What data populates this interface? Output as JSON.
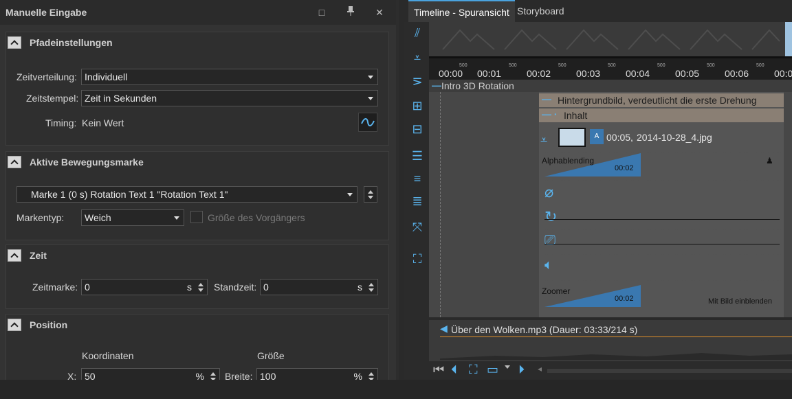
{
  "colors": {
    "accent": "#4aa3df",
    "panel": "#333333",
    "track_bg": "#8a7f74",
    "audio_line": "#e0902a",
    "keyframe": "#3a78b0"
  },
  "left_panel": {
    "title": "Manuelle Eingabe",
    "buttons": {
      "maximize": "□",
      "pin": "pin-icon",
      "close": "✕"
    },
    "pfad": {
      "title": "Pfadeinstellungen",
      "zeitverteilung_label": "Zeitverteilung:",
      "zeitverteilung_value": "Individuell",
      "zeitstempel_label": "Zeitstempel:",
      "zeitstempel_value": "Zeit in Sekunden",
      "timing_label": "Timing:",
      "timing_value": "Kein Wert"
    },
    "marke": {
      "title": "Aktive Bewegungsmarke",
      "selected": "Marke 1 (0 s) Rotation Text 1 \"Rotation Text 1\"",
      "markentyp_label": "Markentyp:",
      "markentyp_value": "Weich",
      "groesse_label": "Größe des Vorgängers"
    },
    "zeit": {
      "title": "Zeit",
      "zeitmarke_label": "Zeitmarke:",
      "zeitmarke_value": "0",
      "zeitmarke_unit": "s",
      "standzeit_label": "Standzeit:",
      "standzeit_value": "0",
      "standzeit_unit": "s"
    },
    "position": {
      "title": "Position",
      "koordinaten_label": "Koordinaten",
      "groesse_label": "Größe",
      "x_label": "X:",
      "x_value": "50",
      "x_unit": "%",
      "breite_label": "Breite:",
      "breite_value": "100",
      "breite_unit": "%"
    }
  },
  "right_panel": {
    "tabs": [
      "Timeline - Spuransicht",
      "Storyboard"
    ],
    "ruler": {
      "major": [
        "00:00",
        "00:01",
        "00:02",
        "00:03",
        "00:04",
        "00:05",
        "00:06",
        "00:0"
      ],
      "minor": "500"
    },
    "tracks": {
      "group": "Intro 3D Rotation",
      "background": "Hintergrundbild, verdeutlicht die erste Drehung",
      "content": "Inhalt",
      "image_time": "00:05,",
      "image_file": "2014-10-28_4.jpg",
      "effect1": "Alphablending",
      "effect1_time": "00:02",
      "effect2": "Zoomer",
      "effect2_time": "00:02",
      "effect2_note": "Mit Bild einblenden"
    },
    "audio": "Über den Wolken.mp3 (Dauer: 03:33/214 s)"
  }
}
